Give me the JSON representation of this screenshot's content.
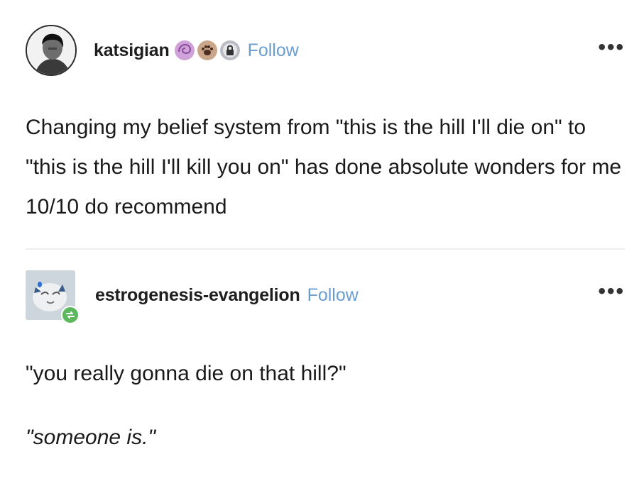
{
  "posts": [
    {
      "username": "katsigian",
      "follow_label": "Follow",
      "more_label": "•••",
      "badges": [
        "swirl-badge-icon",
        "paw-badge-icon",
        "lock-badge-icon"
      ],
      "text": "Changing my belief system from \"this is the hill I'll die on\" to \"this is the hill I'll kill you on\" has done absolute wonders for me 10/10 do recommend"
    },
    {
      "username": "estrogenesis-evangelion",
      "follow_label": "Follow",
      "more_label": "•••",
      "paragraphs": [
        "\"you really gonna die on that hill?\"",
        "\"someone is.\""
      ]
    }
  ],
  "colors": {
    "follow": "#6a9ed0",
    "reblog_badge": "#5cb85c",
    "divider": "#ededed"
  }
}
